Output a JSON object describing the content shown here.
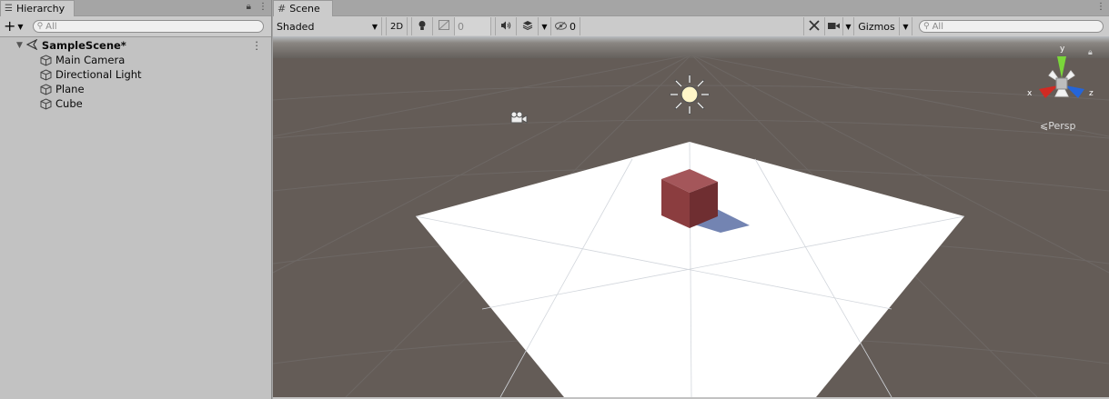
{
  "hierarchy": {
    "tab_label": "Hierarchy",
    "search_placeholder": "All",
    "scene_name": "SampleScene*",
    "items": [
      {
        "label": "Main Camera"
      },
      {
        "label": "Directional Light"
      },
      {
        "label": "Plane"
      },
      {
        "label": "Cube"
      }
    ]
  },
  "scene": {
    "tab_label": "Scene",
    "shading_mode": "Shaded",
    "toggle_2d": "2D",
    "fx_value": "0",
    "hidden_count": "0",
    "gizmos_label": "Gizmos",
    "search_placeholder": "All",
    "gizmo": {
      "x": "x",
      "y": "y",
      "z": "z",
      "projection": "Persp"
    }
  },
  "colors": {
    "panel_bg": "#c2c2c2",
    "viewport_ground": "#645c57",
    "cube_front": "#8b3d3f",
    "gizmo_x": "#d12a23",
    "gizmo_y": "#7ad63a",
    "gizmo_z": "#2565d8"
  }
}
